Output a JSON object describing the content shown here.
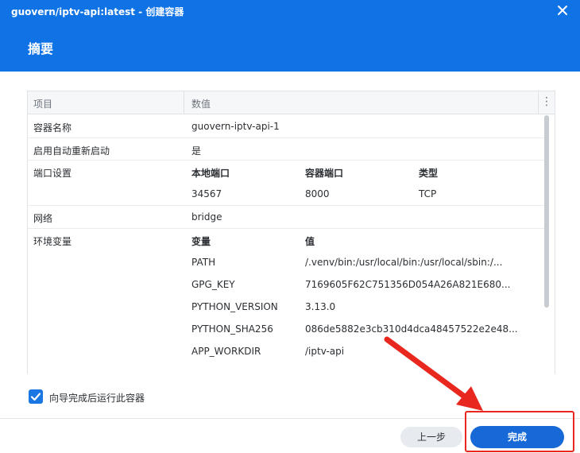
{
  "window": {
    "title": "guovern/iptv-api:latest - 创建容器",
    "page_title": "摘要"
  },
  "table": {
    "header_item": "项目",
    "header_value": "数值",
    "menu_glyph": "⋮",
    "container_name_label": "容器名称",
    "container_name_value": "guovern-iptv-api-1",
    "auto_restart_label": "启用自动重新启动",
    "auto_restart_value": "是",
    "port_label": "端口设置",
    "port_headers": [
      "本地端口",
      "容器端口",
      "类型"
    ],
    "port_values": [
      "34567",
      "8000",
      "TCP"
    ],
    "network_label": "网络",
    "network_value": "bridge",
    "env_label": "环境变量",
    "env_headers": [
      "变量",
      "值"
    ],
    "env_rows": [
      {
        "name": "PATH",
        "value": "/.venv/bin:/usr/local/bin:/usr/local/sbin:/..."
      },
      {
        "name": "GPG_KEY",
        "value": "7169605F62C751356D054A26A821E680..."
      },
      {
        "name": "PYTHON_VERSION",
        "value": "3.13.0"
      },
      {
        "name": "PYTHON_SHA256",
        "value": "086de5882e3cb310d4dca48457522e2e48..."
      },
      {
        "name": "APP_WORKDIR",
        "value": "/iptv-api"
      }
    ]
  },
  "run_after_wizard": {
    "label": "向导完成后运行此容器",
    "checked": true
  },
  "buttons": {
    "prev": "上一步",
    "done": "完成"
  },
  "colors": {
    "accent": "#0f73e6",
    "primary_button": "#1669d6",
    "annotation_red": "#e8281f"
  },
  "icons": {
    "close": "close-icon",
    "column_menu": "more-vertical-icon",
    "checkbox": "checkmark-icon",
    "annotation": "arrow-annotation"
  }
}
